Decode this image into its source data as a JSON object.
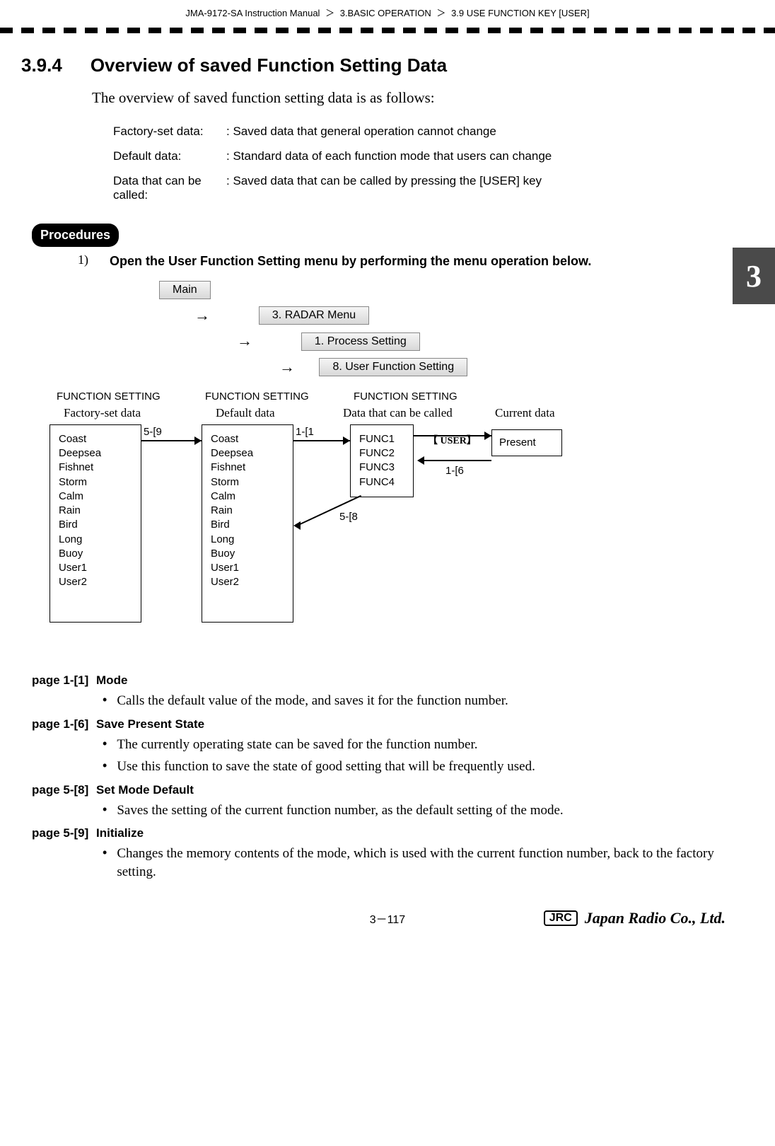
{
  "header": {
    "manual": "JMA-9172-SA Instruction Manual",
    "chapter": "3.BASIC OPERATION",
    "section": "3.9  USE FUNCTION KEY [USER]"
  },
  "sectionTab": "3",
  "title": {
    "num": "3.9.4",
    "text": "Overview of saved Function Setting Data"
  },
  "intro": "The overview of saved function setting data is as follows:",
  "definitions": [
    {
      "label": "Factory-set data:",
      "desc": ": Saved data that general operation cannot change"
    },
    {
      "label": "Default data:",
      "desc": ": Standard data of each function mode that users can change"
    },
    {
      "label": "Data that can be called:",
      "desc": ": Saved data that can be called by pressing the [USER] key"
    }
  ],
  "proceduresLabel": "Procedures",
  "step": {
    "num": "1)",
    "text": "Open the User Function Setting menu by performing the menu operation below."
  },
  "menuPath": {
    "main": "Main",
    "radar": "3. RADAR Menu",
    "process": "1. Process Setting",
    "userFunc": "8. User Function Setting"
  },
  "diagram": {
    "funcSettingHeader": "FUNCTION SETTING",
    "col1Label": "Factory-set data",
    "col2Label": "Default data",
    "col3Label": "Data that can be called",
    "col4Label": "Current data",
    "modeList": [
      "Coast",
      "Deepsea",
      "Fishnet",
      "Storm",
      "Calm",
      "Rain",
      "Bird",
      "Long",
      "Buoy",
      "User1",
      "User2"
    ],
    "funcList": [
      "FUNC1",
      "FUNC2",
      "FUNC3",
      "FUNC4"
    ],
    "presentLabel": "Present",
    "userKey": "【 USER】",
    "ref59": "5-[9",
    "ref11": "1-[1",
    "ref58": "5-[8",
    "ref16": "1-[6"
  },
  "pages": [
    {
      "ref": "page 1-[1]",
      "name": "Mode",
      "bullets": [
        "Calls the default value of the mode, and saves it for the function number."
      ]
    },
    {
      "ref": "page 1-[6]",
      "name": "Save Present State",
      "bullets": [
        "The currently operating state can be saved for the function number.",
        "Use this function to save the state of good setting that will be frequently used."
      ]
    },
    {
      "ref": "page 5-[8]",
      "name": "Set Mode Default",
      "bullets": [
        "Saves the setting of the current function number, as the default setting of the mode."
      ]
    },
    {
      "ref": "page 5-[9]",
      "name": "Initialize",
      "bullets": [
        "Changes the memory contents of the mode, which is used with the current function number, back to the factory setting."
      ]
    }
  ],
  "footer": {
    "pageNum": "3－117",
    "logoBox": "JRC",
    "logoScript": "Japan Radio Co., Ltd."
  }
}
